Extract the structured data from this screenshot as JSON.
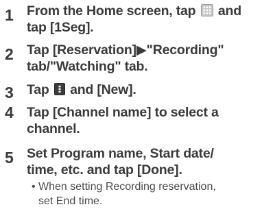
{
  "steps": [
    {
      "number": "1",
      "parts": [
        "From the Home screen, tap",
        "and",
        "tap [1Seg]."
      ],
      "icon": "apps-grid-icon"
    },
    {
      "number": "2",
      "line1": "Tap [Reservation]▶\"Recording\"",
      "line2": "tab/\"Watching\" tab."
    },
    {
      "number": "3",
      "parts": [
        "Tap",
        "and [New]."
      ],
      "icon": "menu-icon"
    },
    {
      "number": "4",
      "line1": "Tap [Channel name] to select a",
      "line2": "channel."
    },
    {
      "number": "5",
      "line1": "Set Program name, Start date/",
      "line2": "time, etc. and tap [Done]."
    }
  ],
  "note": {
    "bullet": "•",
    "line1": "When setting Recording reservation,",
    "line2": "set End time."
  }
}
